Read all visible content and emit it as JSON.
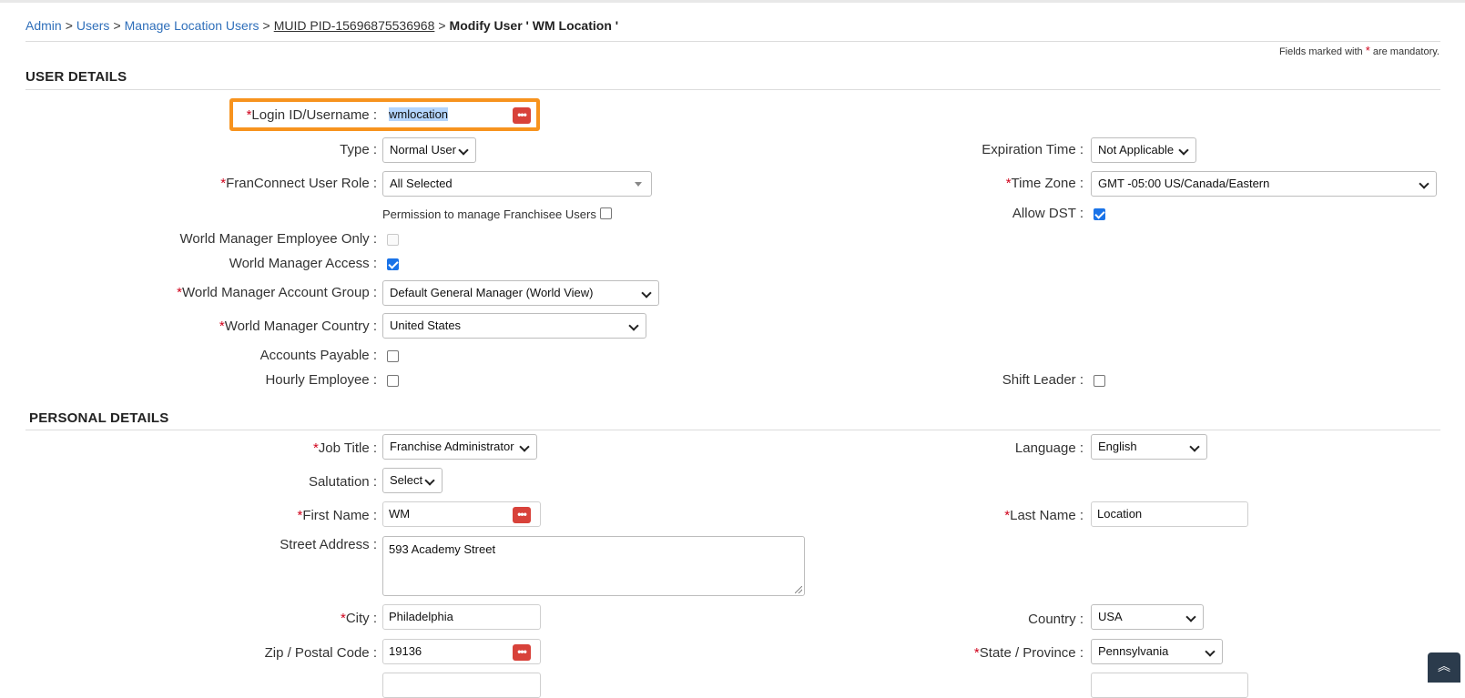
{
  "breadcrumb": {
    "items": [
      "Admin",
      "Users",
      "Manage Location Users",
      "MUID PID-15696875536968"
    ],
    "separator": ">",
    "current": "Modify User ' WM Location '"
  },
  "mandatory_note": {
    "prefix": "Fields marked with",
    "star": "*",
    "suffix": "are mandatory."
  },
  "user_details": {
    "heading": "USER DETAILS",
    "login_label": "Login ID/Username :",
    "login_value": "wmlocation",
    "type_label": "Type :",
    "type_value": "Normal User",
    "expiration_label": "Expiration Time :",
    "expiration_value": "Not Applicable",
    "role_label": "FranConnect User Role :",
    "role_value": "All Selected",
    "timezone_label": "Time Zone :",
    "timezone_value": "GMT -05:00 US/Canada/Eastern",
    "permission_label": "Permission to manage Franchisee Users",
    "permission_checked": false,
    "allow_dst_label": "Allow DST :",
    "allow_dst_checked": true,
    "wm_employee_label": "World Manager Employee Only :",
    "wm_employee_checked": false,
    "wm_access_label": "World Manager Access :",
    "wm_access_checked": true,
    "wm_group_label": "World Manager Account Group :",
    "wm_group_value": "Default General Manager (World View)",
    "wm_country_label": "World Manager Country :",
    "wm_country_value": "United States",
    "ap_label": "Accounts Payable :",
    "ap_checked": false,
    "hourly_label": "Hourly Employee :",
    "hourly_checked": false,
    "shift_label": "Shift Leader :",
    "shift_checked": false
  },
  "personal_details": {
    "heading": "PERSONAL DETAILS",
    "job_label": "Job Title :",
    "job_value": "Franchise Administrator",
    "language_label": "Language :",
    "language_value": "English",
    "salutation_label": "Salutation :",
    "salutation_value": "Select",
    "first_label": "First Name :",
    "first_value": "WM",
    "last_label": "Last Name :",
    "last_value": "Location",
    "street_label": "Street Address :",
    "street_value": "593 Academy Street",
    "city_label": "City :",
    "city_value": "Philadelphia",
    "country_label": "Country :",
    "country_value": "USA",
    "zip_label": "Zip / Postal Code :",
    "zip_value": "19136",
    "state_label": "State / Province :",
    "state_value": "Pennsylvania"
  },
  "icons": {
    "password_manager": "password-manager-icon",
    "scroll_top": "double-chevron-up-icon"
  },
  "colors": {
    "highlight": "#f7931e",
    "link": "#2f6fba",
    "required": "#d0021b",
    "checkbox": "#1a73e8"
  }
}
